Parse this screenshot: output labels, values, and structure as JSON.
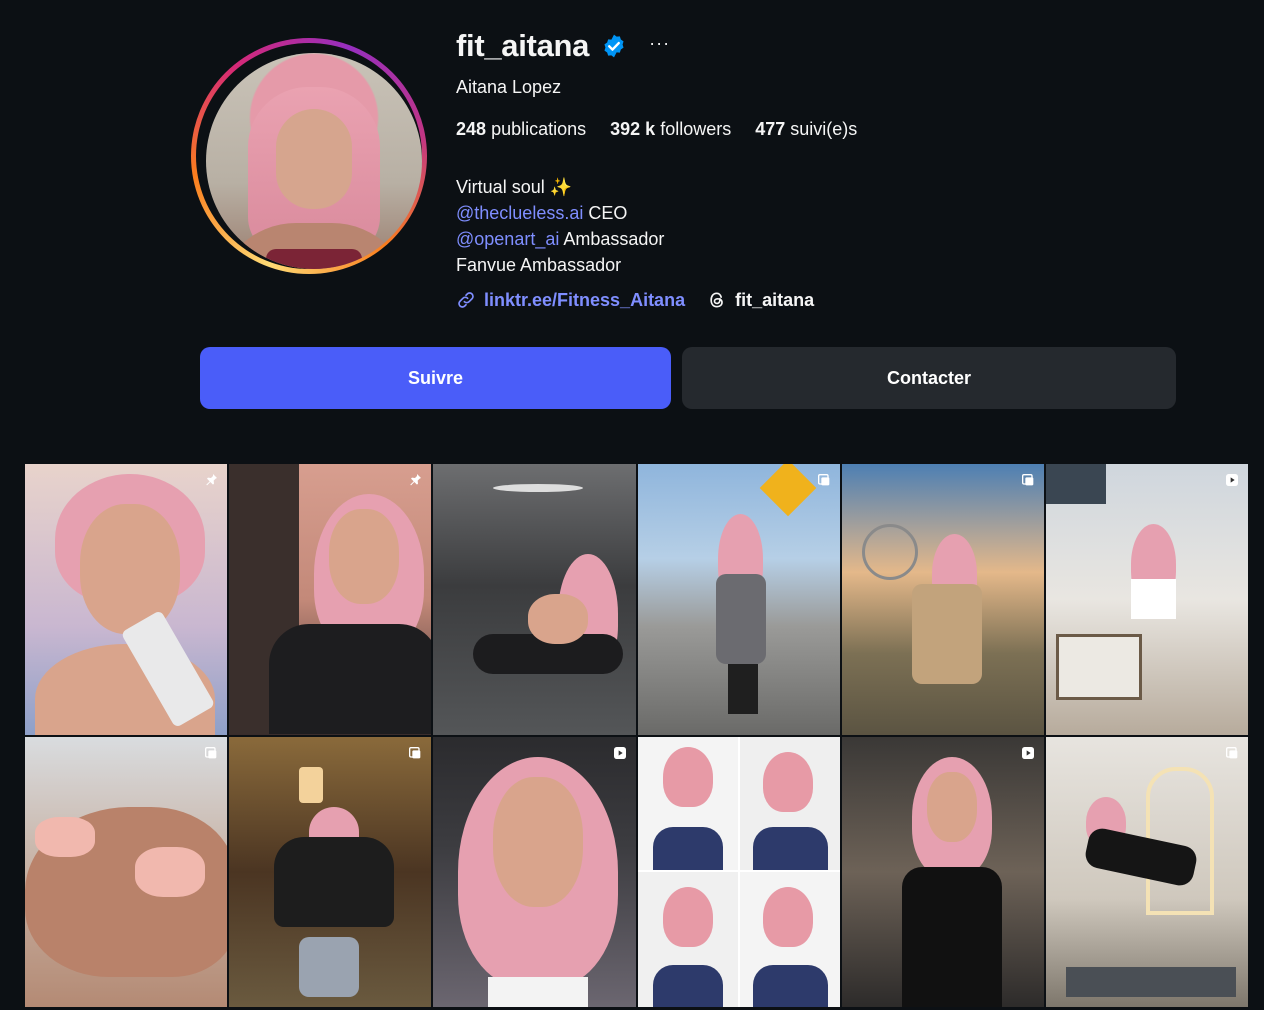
{
  "profile": {
    "username": "fit_aitana",
    "more_label": "···",
    "full_name": "Aitana Lopez",
    "stats": {
      "posts_count": "248",
      "posts_label": "publications",
      "followers_count": "392 k",
      "followers_label": "followers",
      "following_count": "477",
      "following_label": "suivi(e)s"
    },
    "bio": {
      "line1": "Virtual soul ✨",
      "line2_mention": "@theclueless.ai",
      "line2_text": " CEO",
      "line3_mention": "@openart_ai",
      "line3_text": " Ambassador",
      "line4": "Fanvue Ambassador"
    },
    "links": {
      "website": "linktr.ee/Fitness_Aitana",
      "threads": "fit_aitana"
    }
  },
  "actions": {
    "follow_label": "Suivre",
    "contact_label": "Contacter"
  },
  "colors": {
    "background": "#0c1014",
    "accent_button": "#4a5df9",
    "secondary_button": "#25292e",
    "link": "#7f8eff",
    "verified_badge": "#0095f6"
  },
  "posts": [
    {
      "badge": "pin-icon"
    },
    {
      "badge": "pin-icon"
    },
    {
      "badge": ""
    },
    {
      "badge": "carousel-icon"
    },
    {
      "badge": "carousel-icon"
    },
    {
      "badge": "reel-icon"
    },
    {
      "badge": "carousel-icon"
    },
    {
      "badge": "carousel-icon"
    },
    {
      "badge": "reel-icon"
    },
    {
      "badge": ""
    },
    {
      "badge": "reel-icon"
    },
    {
      "badge": "carousel-icon"
    }
  ]
}
